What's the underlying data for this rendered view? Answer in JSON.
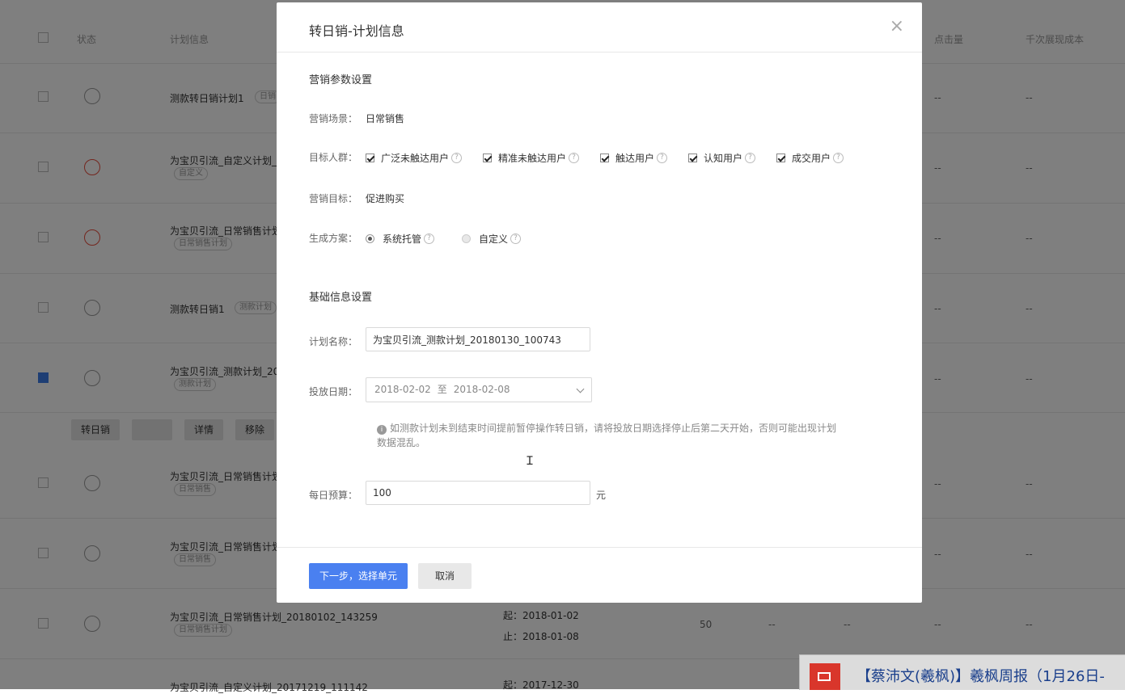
{
  "background": {
    "headers": [
      "状态",
      "计划信息",
      "点击量",
      "千次展现成本"
    ],
    "rows": [
      {
        "name": "测款转日销计划1",
        "tag": "日销",
        "status": "play",
        "checked": false
      },
      {
        "name": "为宝贝引流_自定义计划_",
        "tag": "自定义",
        "status": "pause",
        "checked": false
      },
      {
        "name": "为宝贝引流_日常销售计划",
        "tag": "日常销售计划",
        "status": "pause",
        "checked": false
      },
      {
        "name": "测款转日销1",
        "tag": "测款计划",
        "status": "off",
        "checked": false
      },
      {
        "name": "为宝贝引流_测款计划_20",
        "tag": "测款计划",
        "status": "off",
        "checked": true
      },
      {
        "name": "为宝贝引流_日常销售计划",
        "tag": "日常销售",
        "status": "off",
        "checked": false
      },
      {
        "name": "为宝贝引流_日常销售计划",
        "tag": "日常销售",
        "status": "off",
        "checked": false
      },
      {
        "name": "为宝贝引流_日常销售计划_20180102_143259",
        "tag": "日常销售计划",
        "status": "off",
        "checked": false,
        "start": "起：2018-01-02",
        "end": "止：2018-01-08",
        "budget": "50"
      },
      {
        "name": "为宝贝引流_自定义计划_20171219_111142",
        "tag": "",
        "status": "off",
        "checked": false,
        "start": "起：2017-12-30"
      }
    ],
    "dash": "--",
    "action_buttons": [
      "转日销",
      "",
      "详情",
      "移除"
    ]
  },
  "modal": {
    "title": "转日销-计划信息",
    "close": "×",
    "section1": "营销参数设置",
    "scene_label": "营销场景：",
    "scene_value": "日常销售",
    "target_label": "目标人群：",
    "targets": [
      "广泛未触达用户",
      "精准未触达用户",
      "触达用户",
      "认知用户",
      "成交用户"
    ],
    "goal_label": "营销目标：",
    "goal_value": "促进购买",
    "plan_label": "生成方案：",
    "plan_options": [
      "系统托管",
      "自定义"
    ],
    "help": "?",
    "section2": "基础信息设置",
    "name_label": "计划名称：",
    "name_value": "为宝贝引流_测款计划_20180130_100743",
    "date_label": "投放日期：",
    "date_start": "2018-02-02",
    "date_sep": "至",
    "date_end": "2018-02-08",
    "tip_icon": "i",
    "tip": "如测款计划未到结束时间提前暂停操作转日销，请将投放日期选择停止后第二天开始，否则可能出现计划数据混乱。",
    "budget_label": "每日预算：",
    "budget_value": "100",
    "budget_unit": "元",
    "next_button": "下一步，选择单元",
    "cancel_button": "取消"
  },
  "notification": {
    "text": "【蔡沛文(羲枫)】羲枫周报（1月26日-"
  },
  "colors": {
    "primary": "#4a80f0",
    "overlay": "rgba(0,0,0,0.5)",
    "notif_red": "#d9362b"
  }
}
